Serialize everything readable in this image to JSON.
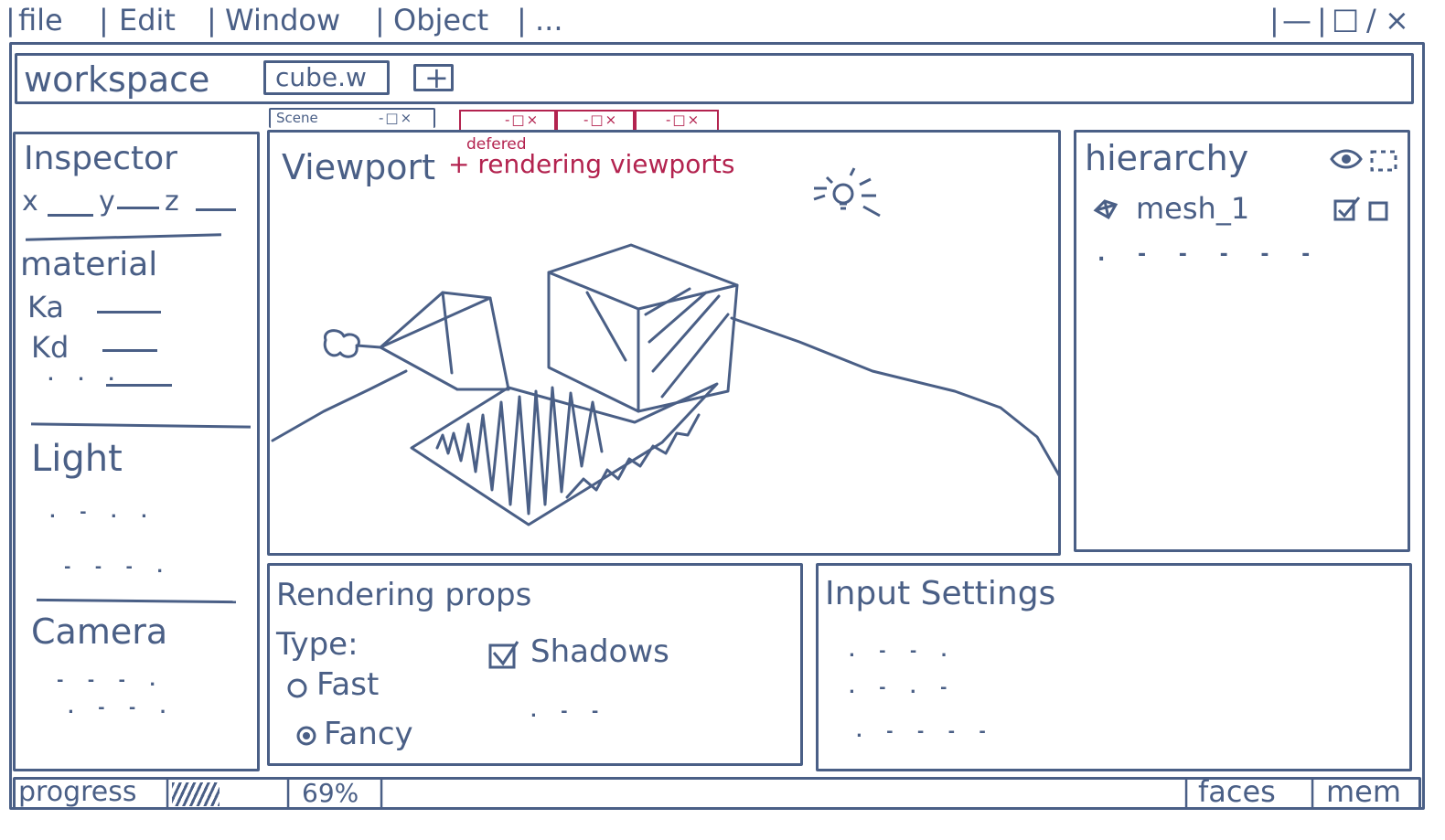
{
  "menu_bar": {
    "items": [
      "file",
      "Edit",
      "Window",
      "Object",
      "..."
    ],
    "window_controls": [
      "—",
      "□",
      "×"
    ]
  },
  "workspace": {
    "label": "workspace",
    "active_tab": "cube.w",
    "add_tab_symbol": "+"
  },
  "viewport_tabs": {
    "scene_tab": {
      "label": "Scene",
      "controls": "-□×"
    },
    "deferred_tabs": [
      {
        "controls": "-□×"
      },
      {
        "controls": "-□×"
      },
      {
        "controls": "-□×"
      }
    ]
  },
  "inspector": {
    "title": "Inspector",
    "coords": [
      "x",
      "y",
      "z"
    ],
    "material": {
      "title": "material",
      "props": [
        "Ka",
        "Kd"
      ],
      "more": ". . ."
    },
    "light": {
      "title": "Light",
      "rows": [
        ". - . .",
        "- - - ."
      ]
    },
    "camera": {
      "title": "Camera",
      "rows": [
        "- - - .",
        ". - - ."
      ]
    }
  },
  "viewport": {
    "title": "Viewport",
    "annotation_small": "defered",
    "annotation": "+ rendering viewports"
  },
  "hierarchy": {
    "title": "hierarchy",
    "items": [
      {
        "label": "mesh_1"
      }
    ],
    "more_rows": ". - - - - -"
  },
  "rendering_props": {
    "title": "Rendering props",
    "type_label": "Type:",
    "options": [
      {
        "label": "Fast",
        "selected": false
      },
      {
        "label": "Fancy",
        "selected": true
      }
    ],
    "shadows_label": "Shadows",
    "shadows_checked": true,
    "more": ". - -"
  },
  "input_settings": {
    "title": "Input Settings",
    "rows": [
      ". - - .",
      ". - . -",
      ". - - - -"
    ]
  },
  "status_bar": {
    "progress_label": "progress",
    "progress_value": 0.69,
    "progress_percent": "69%",
    "faces_label": "faces",
    "mem_label": "mem"
  },
  "colors": {
    "ink": "#4a5f86",
    "annotation": "#b3234f"
  }
}
